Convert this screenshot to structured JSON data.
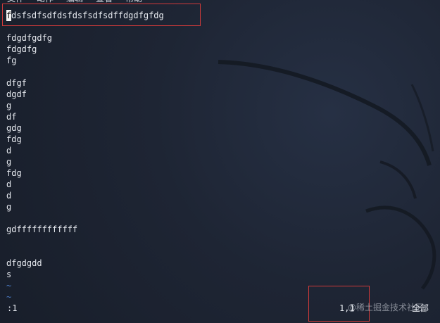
{
  "menu": {
    "items": [
      "文件",
      "动作",
      "编辑",
      "查看",
      "帮助"
    ]
  },
  "editor": {
    "cursor_char": "f",
    "first_line_rest": "dsfsdfsdfdsfdsfsdfsdffdgdfgfdg",
    "lines": [
      "",
      "fdgdfgdfg",
      "fdgdfg",
      "fg",
      "",
      "dfgf",
      "dgdf",
      "g",
      "df",
      "gdg",
      "fdg",
      "d",
      "g",
      "fdg",
      "d",
      "d",
      "g",
      "",
      "gdffffffffffff",
      "",
      "",
      "dfgdgdd",
      "s",
      "~",
      "~"
    ]
  },
  "status": {
    "command": ":1",
    "position": "1,1",
    "scope": "全部"
  },
  "watermark": {
    "text": "@稀土掘金技术社区"
  },
  "colors": {
    "background": "#1c2230",
    "text": "#e6e9ef",
    "tilde": "#4c7cc7",
    "annotation_red": "#d03a3a"
  }
}
